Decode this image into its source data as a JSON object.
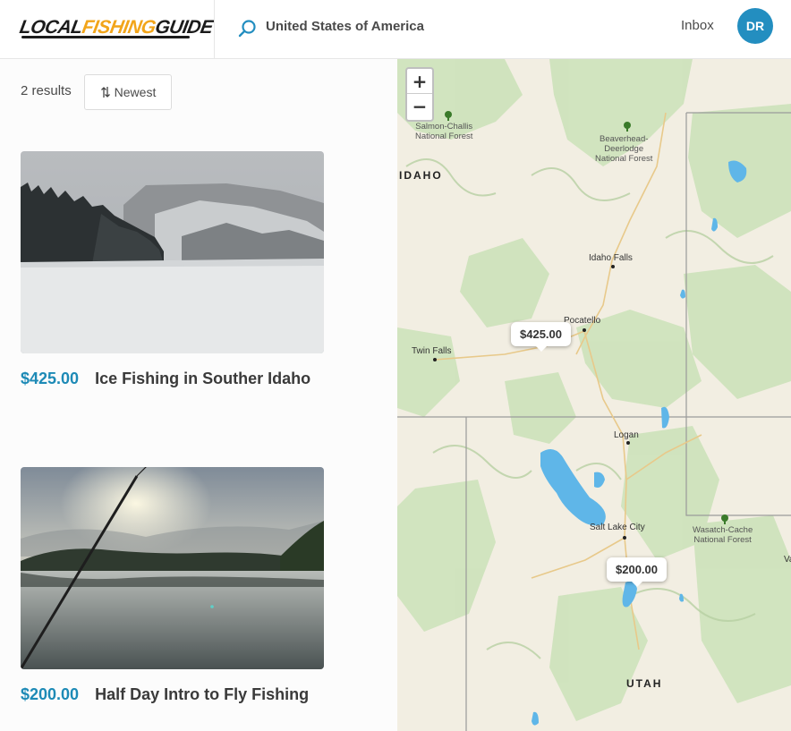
{
  "header": {
    "logo": {
      "part1": "LOCAL",
      "part2": "FISHING",
      "part3": "GUIDE"
    },
    "search_value": "United States of America",
    "inbox_label": "Inbox",
    "avatar_initials": "DR"
  },
  "toolbar": {
    "results_label": "2 results",
    "sort_label": "Newest"
  },
  "listings": [
    {
      "price": "$425.00",
      "title": "Ice Fishing in Souther Idaho"
    },
    {
      "price": "$200.00",
      "title": "Half Day Intro to Fly Fishing"
    }
  ],
  "map": {
    "zoom_in": "+",
    "zoom_out": "−",
    "markers": [
      "$425.00",
      "$200.00"
    ],
    "states": [
      "IDAHO",
      "UTAH"
    ],
    "cities": [
      "Idaho Falls",
      "Pocatello",
      "Twin Falls",
      "Logan",
      "Salt Lake City"
    ],
    "forests": [
      {
        "line1": "Salmon-Challis",
        "line2": "National Forest"
      },
      {
        "line1": "Beaverhead-",
        "line2": "Deerlodge",
        "line3": "National Forest"
      },
      {
        "line1": "Wasatch-Cache",
        "line2": "National Forest"
      }
    ],
    "edge_label": "Va"
  },
  "colors": {
    "accent": "#1d8ab6",
    "avatar": "#238ec0",
    "logo_orange": "#f2a51a"
  }
}
